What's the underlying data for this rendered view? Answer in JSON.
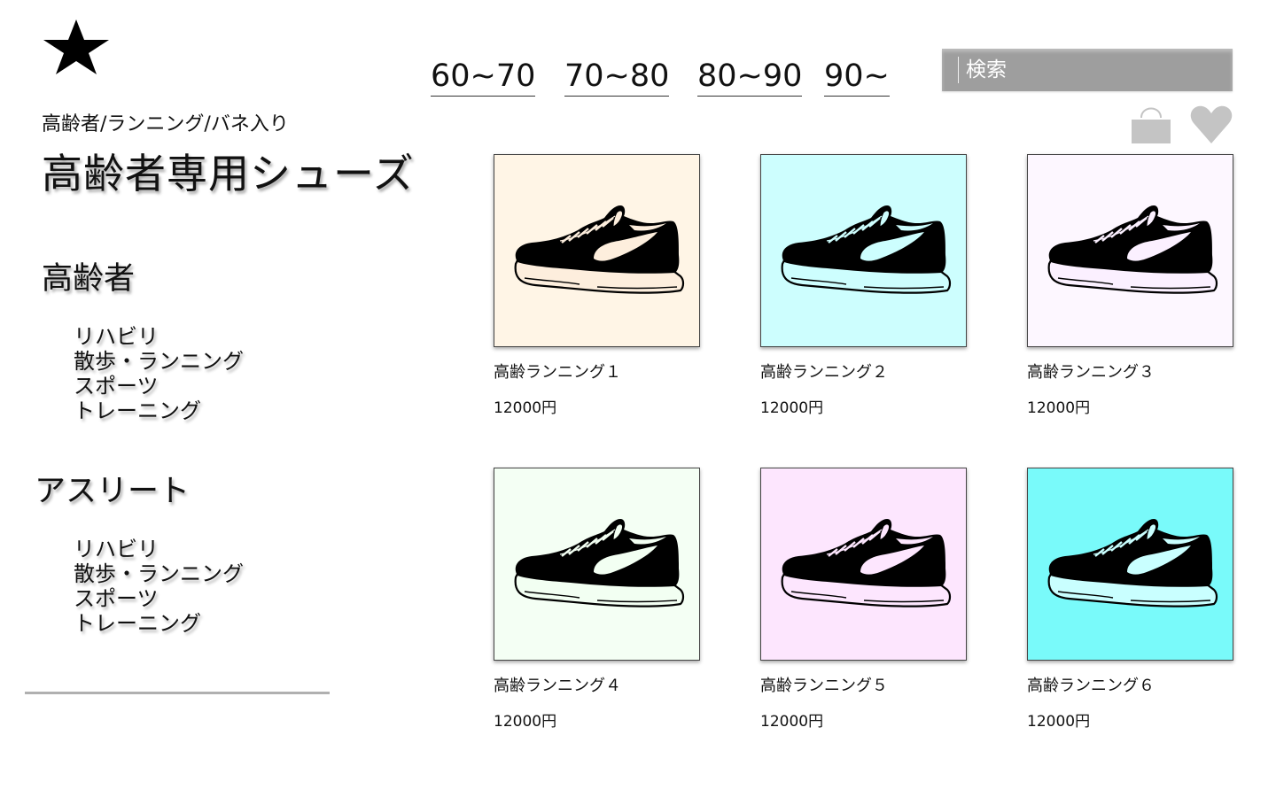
{
  "logo": {
    "icon": "star-icon"
  },
  "age_filters": [
    "60~70",
    "70~80",
    "80~90",
    "90~"
  ],
  "search": {
    "placeholder": "検索"
  },
  "header_icons": {
    "bag": "shopping-bag-icon",
    "favorite": "heart-icon",
    "color": "#c4c4c4"
  },
  "breadcrumb": "高齢者/ランニング/バネ入り",
  "page_title": "高齢者専用シューズ",
  "sidebar": {
    "groups": [
      {
        "heading": "高齢者",
        "items": [
          "リハビリ",
          "散歩・ランニング",
          "スポーツ",
          "トレーニング"
        ]
      },
      {
        "heading": "アスリート",
        "items": [
          "リハビリ",
          "散歩・ランニング",
          "スポーツ",
          "トレーニング"
        ]
      }
    ]
  },
  "products": [
    {
      "name": "高齢ランニング１",
      "price": "12000円",
      "bg": "#fff5e6",
      "sole": "#fdeedd",
      "accent": "#fdeedd"
    },
    {
      "name": "高齢ランニング２",
      "price": "12000円",
      "bg": "#cdfefe",
      "sole": "#cdfefe",
      "accent": "#cdfefe"
    },
    {
      "name": "高齢ランニング３",
      "price": "12000円",
      "bg": "#fdf7ff",
      "sole": "#fbf0ff",
      "accent": "#fbf0ff"
    },
    {
      "name": "高齢ランニング４",
      "price": "12000円",
      "bg": "#f4fff4",
      "sole": "#f2fff2",
      "accent": "#f2fff2"
    },
    {
      "name": "高齢ランニング５",
      "price": "12000円",
      "bg": "#fde6fe",
      "sole": "#fde6fe",
      "accent": "#fde6fe"
    },
    {
      "name": "高齢ランニング６",
      "price": "12000円",
      "bg": "#79fafa",
      "sole": "#c9ffff",
      "accent": "#c9ffff"
    }
  ]
}
